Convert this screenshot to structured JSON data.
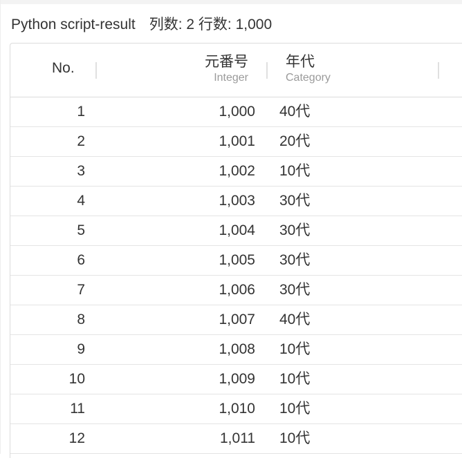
{
  "title": "Python script-result",
  "summary": "列数: 2 行数: 1,000",
  "columns": {
    "no": {
      "label": "No."
    },
    "value": {
      "label": "元番号",
      "type": "Integer"
    },
    "category": {
      "label": "年代",
      "type": "Category"
    }
  },
  "rows": [
    {
      "no": "1",
      "value": "1,000",
      "category": "40代"
    },
    {
      "no": "2",
      "value": "1,001",
      "category": "20代"
    },
    {
      "no": "3",
      "value": "1,002",
      "category": "10代"
    },
    {
      "no": "4",
      "value": "1,003",
      "category": "30代"
    },
    {
      "no": "5",
      "value": "1,004",
      "category": "30代"
    },
    {
      "no": "6",
      "value": "1,005",
      "category": "30代"
    },
    {
      "no": "7",
      "value": "1,006",
      "category": "30代"
    },
    {
      "no": "8",
      "value": "1,007",
      "category": "40代"
    },
    {
      "no": "9",
      "value": "1,008",
      "category": "10代"
    },
    {
      "no": "10",
      "value": "1,009",
      "category": "10代"
    },
    {
      "no": "11",
      "value": "1,010",
      "category": "10代"
    },
    {
      "no": "12",
      "value": "1,011",
      "category": "10代"
    }
  ]
}
